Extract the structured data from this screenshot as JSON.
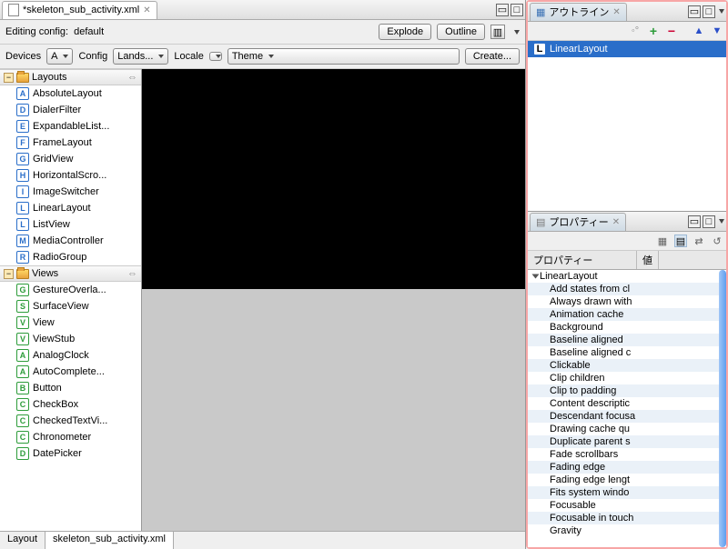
{
  "editor": {
    "tab_title": "*skeleton_sub_activity.xml",
    "config_label": "Editing config:",
    "config_value": "default",
    "explode": "Explode",
    "outline": "Outline",
    "devices_label": "Devices",
    "devices_value": "A",
    "config_short": "Config",
    "config_combo": "Lands...",
    "locale_label": "Locale",
    "theme_combo": "Theme",
    "create": "Create...",
    "bottom_tabs": [
      "Layout",
      "skeleton_sub_activity.xml"
    ]
  },
  "palette": {
    "sections": [
      {
        "title": "Layouts",
        "items": [
          {
            "glyph": "A",
            "cls": "ic-a",
            "label": "AbsoluteLayout"
          },
          {
            "glyph": "D",
            "cls": "ic-d",
            "label": "DialerFilter"
          },
          {
            "glyph": "E",
            "cls": "ic-e",
            "label": "ExpandableList..."
          },
          {
            "glyph": "F",
            "cls": "ic-f",
            "label": "FrameLayout"
          },
          {
            "glyph": "G",
            "cls": "ic-g",
            "label": "GridView"
          },
          {
            "glyph": "H",
            "cls": "ic-h",
            "label": "HorizontalScro..."
          },
          {
            "glyph": "I",
            "cls": "ic-i",
            "label": "ImageSwitcher"
          },
          {
            "glyph": "L",
            "cls": "ic-l",
            "label": "LinearLayout"
          },
          {
            "glyph": "L",
            "cls": "ic-l",
            "label": "ListView"
          },
          {
            "glyph": "M",
            "cls": "ic-m",
            "label": "MediaController"
          },
          {
            "glyph": "R",
            "cls": "ic-r",
            "label": "RadioGroup"
          }
        ]
      },
      {
        "title": "Views",
        "items": [
          {
            "glyph": "G",
            "cls": "ic-green",
            "label": "GestureOverla..."
          },
          {
            "glyph": "S",
            "cls": "ic-green",
            "label": "SurfaceView"
          },
          {
            "glyph": "V",
            "cls": "ic-green",
            "label": "View"
          },
          {
            "glyph": "V",
            "cls": "ic-green",
            "label": "ViewStub"
          },
          {
            "glyph": "A",
            "cls": "ic-green",
            "label": "AnalogClock"
          },
          {
            "glyph": "A",
            "cls": "ic-green",
            "label": "AutoComplete..."
          },
          {
            "glyph": "B",
            "cls": "ic-green",
            "label": "Button"
          },
          {
            "glyph": "C",
            "cls": "ic-green",
            "label": "CheckBox"
          },
          {
            "glyph": "C",
            "cls": "ic-green",
            "label": "CheckedTextVi..."
          },
          {
            "glyph": "C",
            "cls": "ic-green",
            "label": "Chronometer"
          },
          {
            "glyph": "D",
            "cls": "ic-green",
            "label": "DatePicker"
          }
        ]
      }
    ]
  },
  "outline": {
    "title": "アウトライン",
    "selected": {
      "glyph": "L",
      "label": "LinearLayout"
    }
  },
  "properties": {
    "title": "プロパティー",
    "col1": "プロパティー",
    "col2": "値",
    "root": "LinearLayout",
    "rows": [
      "Add states from cl",
      "Always drawn with",
      "Animation cache",
      "Background",
      "Baseline aligned",
      "Baseline aligned c",
      "Clickable",
      "Clip children",
      "Clip to padding",
      "Content descriptic",
      "Descendant focusa",
      "Drawing cache qu",
      "Duplicate parent s",
      "Fade scrollbars",
      "Fading edge",
      "Fading edge lengt",
      "Fits system windo",
      "Focusable",
      "Focusable in touch",
      "Gravity"
    ]
  }
}
